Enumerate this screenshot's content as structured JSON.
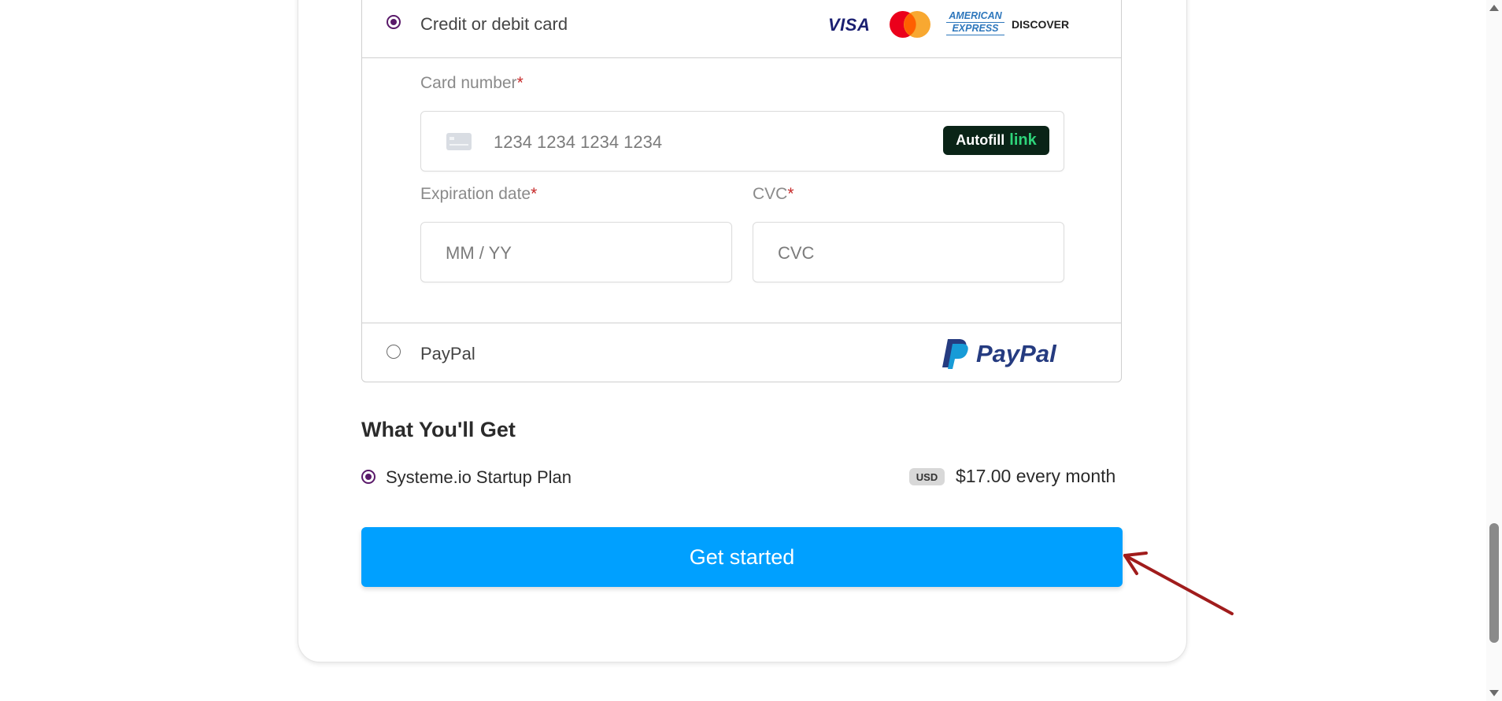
{
  "payment": {
    "card_option_label": "Credit or debit card",
    "card_brands": [
      "VISA",
      "AMERICAN",
      "EXPRESS",
      "DISCOVER"
    ],
    "card_number_label": "Card number",
    "card_number_placeholder": "1234 1234 1234 1234",
    "autofill_label": "Autofill",
    "autofill_link": "link",
    "expiration_label": "Expiration date",
    "expiration_placeholder": "MM / YY",
    "cvc_label": "CVC",
    "cvc_placeholder": "CVC",
    "required_mark": "*",
    "paypal_option_label": "PayPal",
    "paypal_logo_text": "PayPal"
  },
  "summary": {
    "title": "What You'll Get",
    "plan_name": "Systeme.io Startup Plan",
    "currency_badge": "USD",
    "price": "$17.00 every month"
  },
  "cta": {
    "label": "Get started"
  },
  "colors": {
    "cta": "#00a0ff",
    "radio_selected": "#5a1a6a",
    "required": "#c62828",
    "annotation_arrow": "#a01c1c"
  }
}
